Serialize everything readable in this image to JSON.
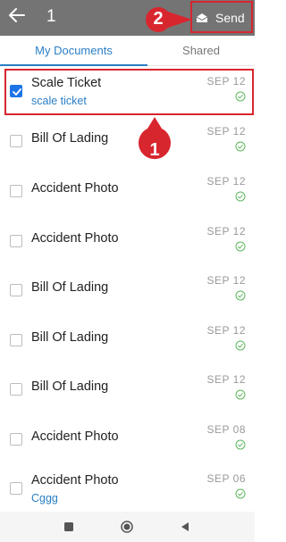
{
  "header": {
    "selected_count": "1",
    "send_label": "Send"
  },
  "tabs": [
    {
      "label": "My Documents",
      "active": true
    },
    {
      "label": "Shared",
      "active": false
    }
  ],
  "documents": [
    {
      "name": "Scale Ticket",
      "subtitle": "scale ticket",
      "date": "SEP 12",
      "checked": true,
      "status": "check-circle-icon"
    },
    {
      "name": "Bill Of Lading",
      "subtitle": "",
      "date": "SEP 12",
      "checked": false,
      "status": "check-circle-icon"
    },
    {
      "name": "Accident Photo",
      "subtitle": "",
      "date": "SEP 12",
      "checked": false,
      "status": "check-circle-icon"
    },
    {
      "name": "Accident Photo",
      "subtitle": "",
      "date": "SEP 12",
      "checked": false,
      "status": "check-circle-icon"
    },
    {
      "name": "Bill Of Lading",
      "subtitle": "",
      "date": "SEP 12",
      "checked": false,
      "status": "check-circle-icon"
    },
    {
      "name": "Bill Of Lading",
      "subtitle": "",
      "date": "SEP 12",
      "checked": false,
      "status": "check-circle-icon"
    },
    {
      "name": "Bill Of Lading",
      "subtitle": "",
      "date": "SEP 12",
      "checked": false,
      "status": "check-circle-icon"
    },
    {
      "name": "Accident Photo",
      "subtitle": "",
      "date": "SEP 08",
      "checked": false,
      "status": "check-circle-icon"
    },
    {
      "name": "Accident Photo",
      "subtitle": "Cggg",
      "date": "SEP 06",
      "checked": false,
      "status": "check-circle-icon"
    }
  ],
  "annotations": {
    "step1": "1",
    "step2": "2"
  },
  "colors": {
    "header_bg": "#747474",
    "accent": "#2a7ec5",
    "checkbox_on": "#1e74e6",
    "annotation_red": "#d8262f",
    "status_green": "#5cb85c"
  }
}
